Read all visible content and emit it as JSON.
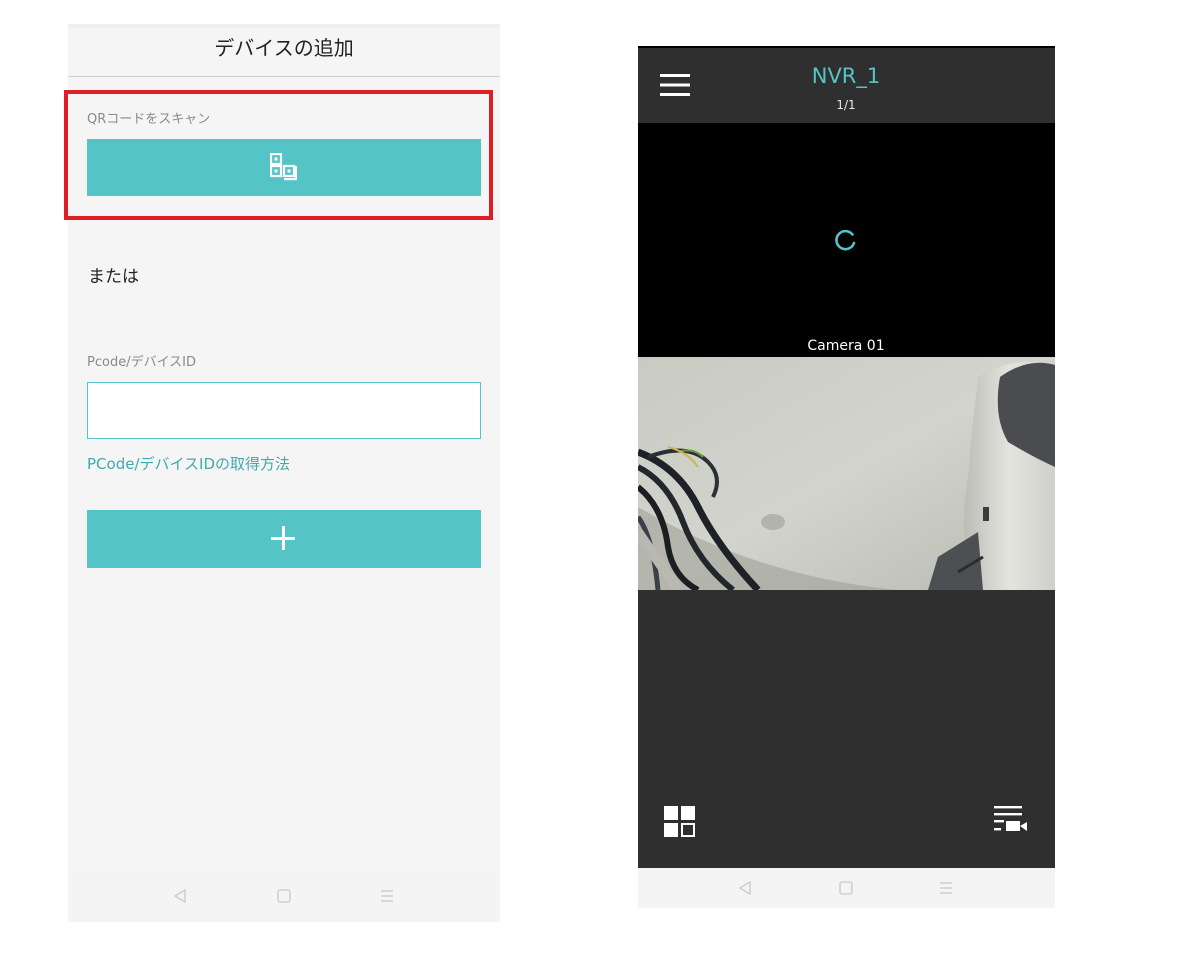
{
  "add_device_screen": {
    "title": "デバイスの追加",
    "qr_section_label": "QRコードをスキャン",
    "qr_button_icon": "qr-code-icon",
    "or_text": "または",
    "pcode_label": "Pcode/デバイスID",
    "pcode_input_value": "",
    "pcode_help_link": "PCode/デバイスIDの取得方法",
    "add_button_icon": "plus-icon",
    "highlight_color": "#e01e26",
    "accent_color": "#55c4c6"
  },
  "live_view_screen": {
    "title": "NVR_1",
    "page_indicator": "1/1",
    "channel_name": "Camera 01",
    "menu_icon": "hamburger-menu-icon",
    "loading_icon": "loading-spinner-icon",
    "layout_icon": "grid-layout-icon",
    "playlist_icon": "camera-list-icon"
  },
  "android_nav": {
    "back": "back-icon",
    "home": "home-icon",
    "recents": "recents-icon"
  }
}
